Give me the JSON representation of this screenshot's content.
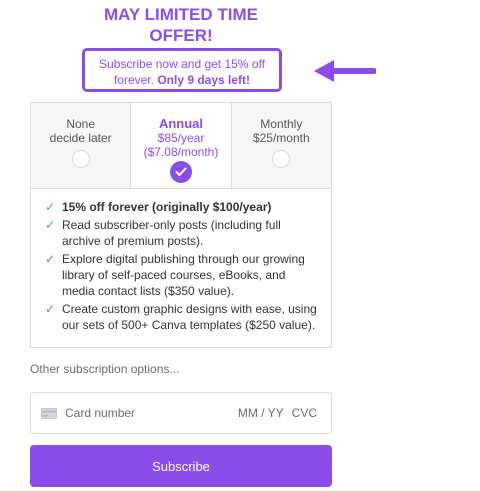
{
  "promo": {
    "title_line1": "MAY LIMITED TIME",
    "title_line2": "OFFER!",
    "offer_text": "Subscribe now and get 15% off forever.",
    "offer_emphasis": "Only 9 days left!"
  },
  "plans": [
    {
      "name": "None",
      "price": "decide later",
      "sub": "",
      "selected": false
    },
    {
      "name": "Annual",
      "price": "$85/year",
      "sub": "($7.08/month)",
      "selected": true
    },
    {
      "name": "Monthly",
      "price": "$25/month",
      "sub": "",
      "selected": false
    }
  ],
  "features": [
    "15% off forever (originally $100/year)",
    "Read subscriber-only posts (including full archive of premium posts).",
    "Explore digital publishing through our growing library of self-paced courses, eBooks, and media contact lists ($350 value).",
    "Create custom graphic designs with ease, using our sets of 500+ Canva templates ($250 value)."
  ],
  "check_glyph": "✓",
  "other_options": "Other subscription options...",
  "card": {
    "placeholder": "Card number",
    "expiry": "MM / YY",
    "cvc": "CVC",
    "icon": "credit-card-icon"
  },
  "subscribe_label": "Subscribe",
  "colors": {
    "accent": "#8a4dea",
    "check": "#2fb34b"
  }
}
